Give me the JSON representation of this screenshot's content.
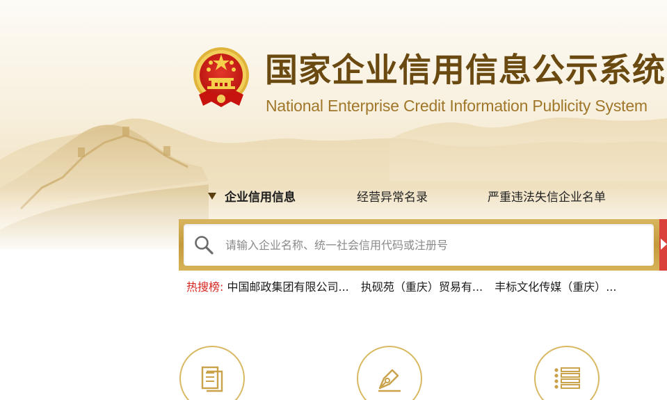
{
  "header": {
    "title_cn": "国家企业信用信息公示系统",
    "title_en": "National Enterprise Credit Information Publicity System"
  },
  "tabs": [
    {
      "label": "企业信用信息",
      "active": true
    },
    {
      "label": "经营异常名录",
      "active": false
    },
    {
      "label": "严重违法失信企业名单",
      "active": false
    }
  ],
  "search": {
    "placeholder": "请输入企业名称、统一社会信用代码或注册号",
    "value": ""
  },
  "hot_search": {
    "label": "热搜榜:",
    "items": [
      "中国邮政集团有限公司...",
      "执砚苑（重庆）贸易有...",
      "丰标文化传媒（重庆）..."
    ]
  },
  "features": [
    {
      "icon": "document-icon"
    },
    {
      "icon": "pen-nib-icon"
    },
    {
      "icon": "list-icon"
    }
  ],
  "colors": {
    "brand_brown": "#6b4a12",
    "gold": "#c49a3c",
    "hot_red": "#d7261f",
    "button_red": "#d9413a"
  }
}
